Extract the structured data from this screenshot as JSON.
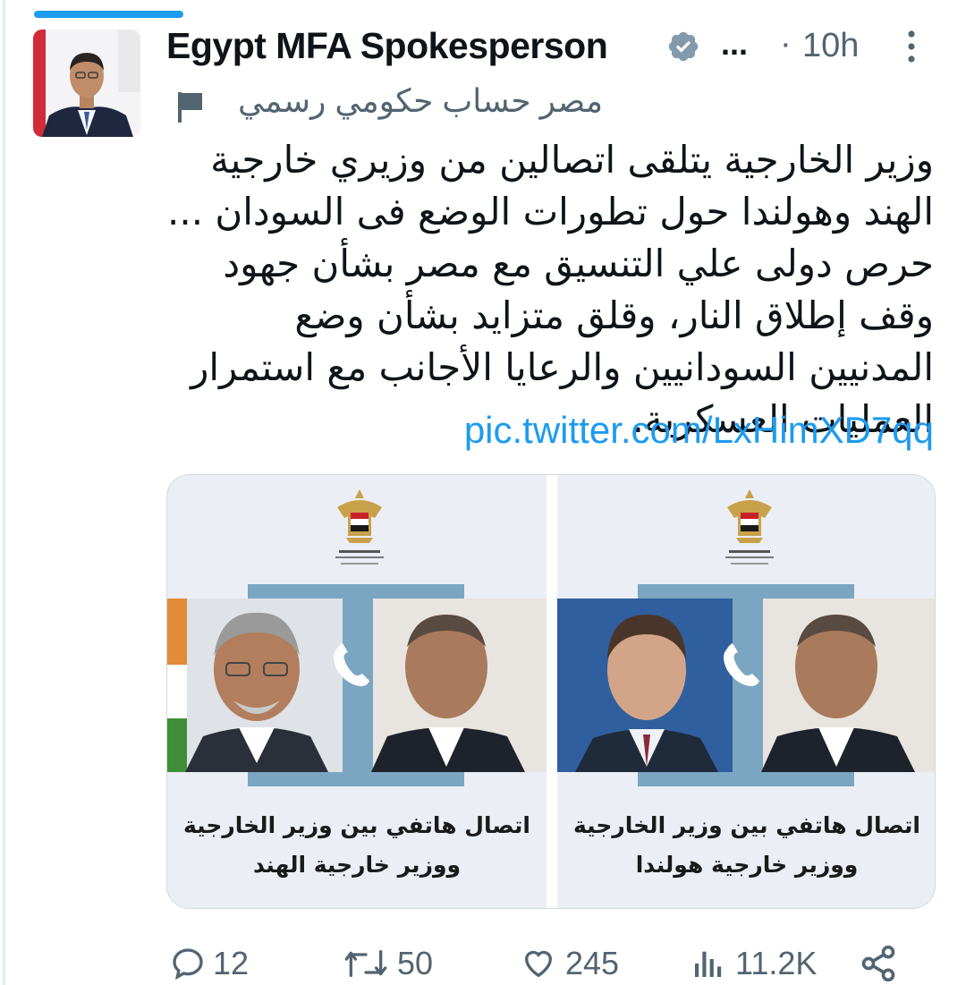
{
  "header": {
    "display_name": "Egypt MFA Spokesperson",
    "overflow": "...",
    "separator": "·",
    "time": "10h",
    "affiliation_label": "مصر حساب حكومي رسمي"
  },
  "tweet": {
    "text": "وزير الخارجية يتلقى اتصالين من وزيري خارجية الهند وهولندا حول تطورات الوضع فى السودان ... حرص دولى علي التنسيق مع مصر بشأن جهود وقف إطلاق النار، وقلق متزايد بشأن وضع المدنيين السودانيين والرعايا الأجانب مع استمرار العمليات العسكرية.",
    "link": "pic.twitter.com/LxHimXD7qq"
  },
  "media": {
    "cards": [
      {
        "caption_line1": "اتصال هاتفي بين وزير الخارجية",
        "caption_line2": "ووزير خارجية الهند"
      },
      {
        "caption_line1": "اتصال هاتفي بين وزير الخارجية",
        "caption_line2": "ووزير خارجية هولندا"
      }
    ]
  },
  "actions": {
    "replies": "12",
    "reposts": "50",
    "likes": "245",
    "views": "11.2K"
  },
  "icons": {
    "verified": "verified-badge-icon",
    "more": "more-vertical-icon",
    "flag": "flag-icon",
    "reply": "reply-icon",
    "repost": "repost-icon",
    "like": "heart-icon",
    "views": "analytics-icon",
    "share": "share-icon"
  },
  "colors": {
    "accent": "#1d9bf0",
    "muted": "#536471",
    "verified_badge": "#829aab",
    "card_bg": "#eceef5",
    "frame_blue": "#7aa6c2"
  }
}
